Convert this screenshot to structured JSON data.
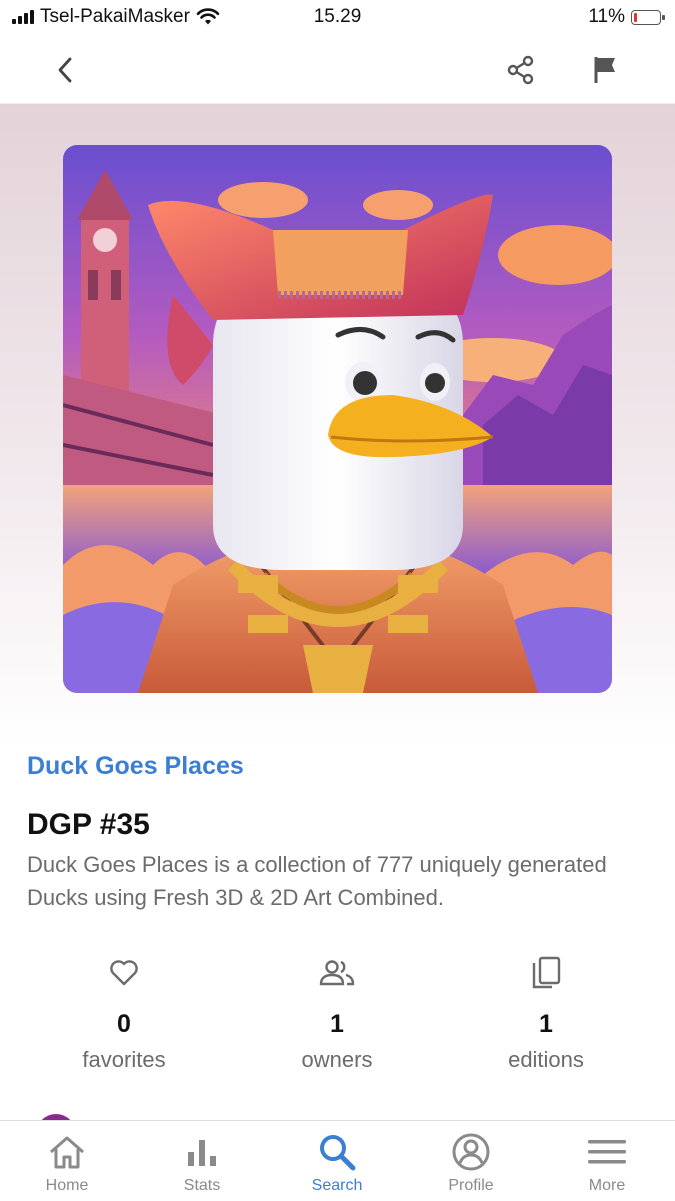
{
  "status_bar": {
    "carrier": "Tsel-PakaiMasker",
    "time": "15.29",
    "battery": "11%",
    "battery_level": 0.11
  },
  "nav": {
    "back_icon": "chevron-left-icon",
    "share_icon": "share-icon",
    "report_icon": "flag-icon"
  },
  "item": {
    "collection": "Duck Goes Places",
    "title": "DGP #35",
    "description": "Duck Goes Places is a collection of 777 uniquely generated Ducks using Fresh 3D & 2D Art Combined."
  },
  "stats": [
    {
      "icon": "heart-icon",
      "value": "0",
      "label": "favorites"
    },
    {
      "icon": "people-icon",
      "value": "1",
      "label": "owners"
    },
    {
      "icon": "copies-icon",
      "value": "1",
      "label": "editions"
    }
  ],
  "tabs": [
    {
      "icon": "home-icon",
      "label": "Home"
    },
    {
      "icon": "bar-chart-icon",
      "label": "Stats"
    },
    {
      "icon": "search-icon",
      "label": "Search",
      "active": true
    },
    {
      "icon": "profile-icon",
      "label": "Profile"
    },
    {
      "icon": "menu-icon",
      "label": "More"
    }
  ],
  "colors": {
    "accent": "#3b7fd4",
    "battery_low": "#e0322f"
  }
}
